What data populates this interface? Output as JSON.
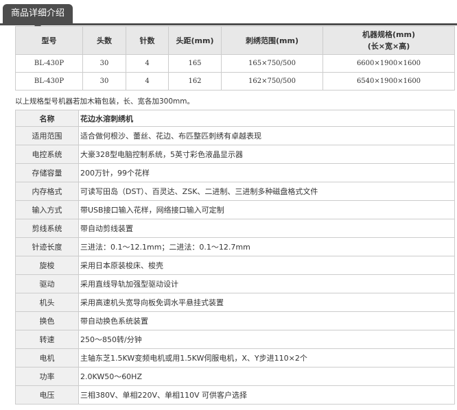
{
  "tab": {
    "label": "商品详细介绍"
  },
  "spec_table": {
    "headers": [
      "型号",
      "头数",
      "针数",
      "头距(mm)",
      "刺绣范围(mm)",
      "机器规格(mm)",
      "(长×宽×高)"
    ],
    "rows": [
      [
        "BL-430P",
        "30",
        "4",
        "165",
        "165×750/500",
        "6600×1900×1600"
      ],
      [
        "BL-430P",
        "30",
        "4",
        "162",
        "162×750/500",
        "6540×1900×1600"
      ]
    ]
  },
  "note": "以上规格型号机器若加木箱包装，长、宽各加300mm。",
  "params": {
    "head_key": "名称",
    "head_value": "花边水溶刺绣机",
    "rows": [
      {
        "k": "适用范围",
        "v": "适合做何根沙、蕾丝、花边、布匹整匹刺绣有卓越表现"
      },
      {
        "k": "电控系统",
        "v": "大豪328型电脑控制系统，5英寸彩色液晶显示器"
      },
      {
        "k": "存储容量",
        "v": "200万针，99个花样"
      },
      {
        "k": "内存格式",
        "v": "可读写田岛（DST）、百灵达、ZSK、二进制、三进制多种磁盘格式文件"
      },
      {
        "k": "输入方式",
        "v": "带USB接口输入花样，网络接口输入可定制"
      },
      {
        "k": "剪线系统",
        "v": "带自动剪线装置"
      },
      {
        "k": "针迹长度",
        "v": "三进法：0.1～12.1mm；二进法：0.1～12.7mm"
      },
      {
        "k": "旋梭",
        "v": "采用日本原装梭床、梭壳"
      },
      {
        "k": "驱动",
        "v": "采用直线导轨加强型驱动设计"
      },
      {
        "k": "机头",
        "v": "采用高速机头宽导向板免调水平悬挂式装置"
      },
      {
        "k": "换色",
        "v": "带自动换色系统装置"
      },
      {
        "k": "转速",
        "v": "250～850转/分钟"
      },
      {
        "k": "电机",
        "v": "主轴东芝1.5KW变频电机或用1.5KW伺服电机，X、Y步进110×2个"
      },
      {
        "k": "功率",
        "v": "2.0KW50～60HZ"
      },
      {
        "k": "电压",
        "v": "三相380V、单相220V、单相110V 可供客户选择"
      }
    ]
  }
}
